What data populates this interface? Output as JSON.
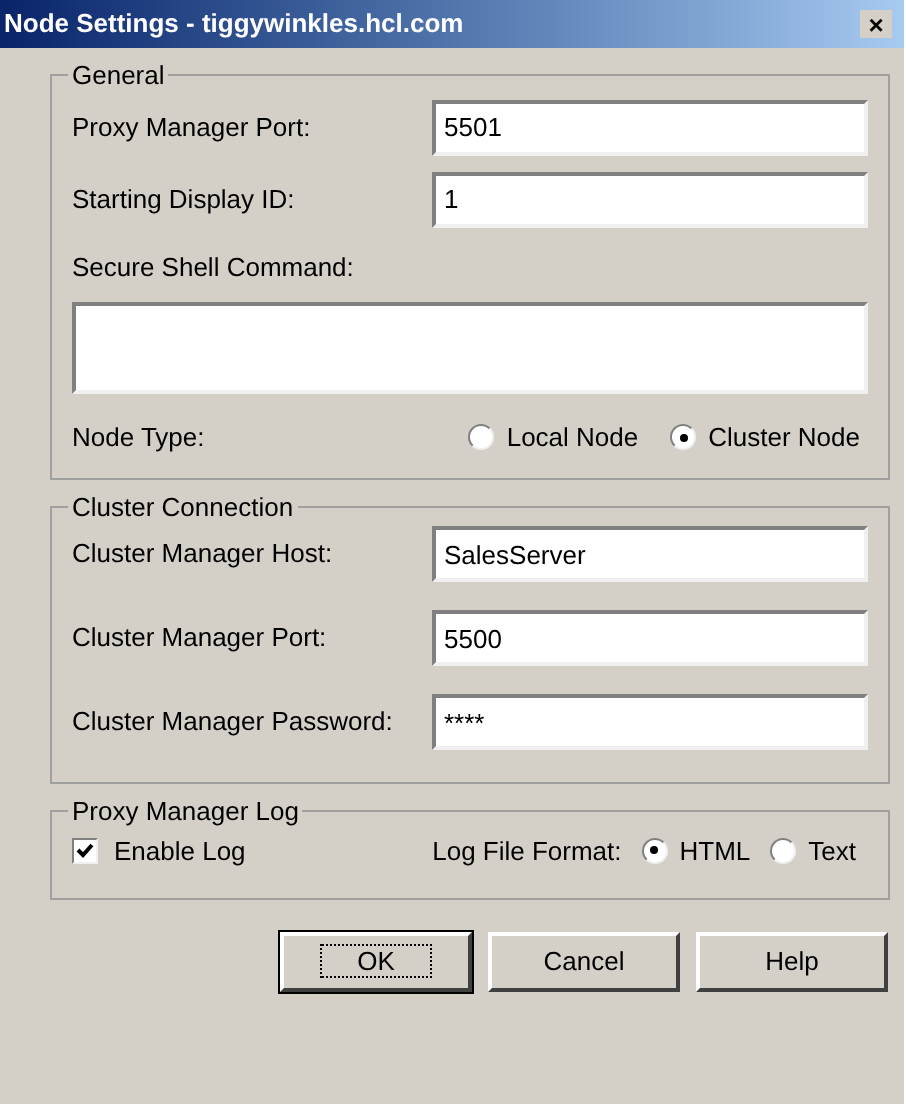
{
  "window": {
    "title": "Node Settings - tiggywinkles.hcl.com",
    "close": "×"
  },
  "general": {
    "legend": "General",
    "fields": [
      {
        "label": "Proxy Manager Port:",
        "value": "5501"
      },
      {
        "label": "Starting Display ID:",
        "value": "1"
      }
    ],
    "command": {
      "label": "Secure Shell Command:"
    },
    "node_type": {
      "label": "Node Type:",
      "options": [
        {
          "label": "Local Node",
          "selected": false
        },
        {
          "label": "Cluster Node",
          "selected": true
        }
      ]
    }
  },
  "cluster": {
    "legend": "Cluster Connection",
    "fields": [
      {
        "label": "Cluster Manager Host:",
        "value": "SalesServer"
      },
      {
        "label": "Cluster Manager Port:",
        "value": "5500"
      },
      {
        "label": "Cluster Manager Password:",
        "value": "****"
      }
    ]
  },
  "log": {
    "legend": "Proxy Manager Log",
    "enable": {
      "label": "Enable Log",
      "checked": true
    },
    "format": {
      "label": "Log File Format:",
      "options": [
        {
          "label": "HTML",
          "selected": true
        },
        {
          "label": "Text",
          "selected": false
        }
      ]
    }
  },
  "buttons": [
    {
      "label": "OK",
      "default": true
    },
    {
      "label": "Cancel",
      "default": false
    },
    {
      "label": "Help",
      "default": false
    }
  ]
}
